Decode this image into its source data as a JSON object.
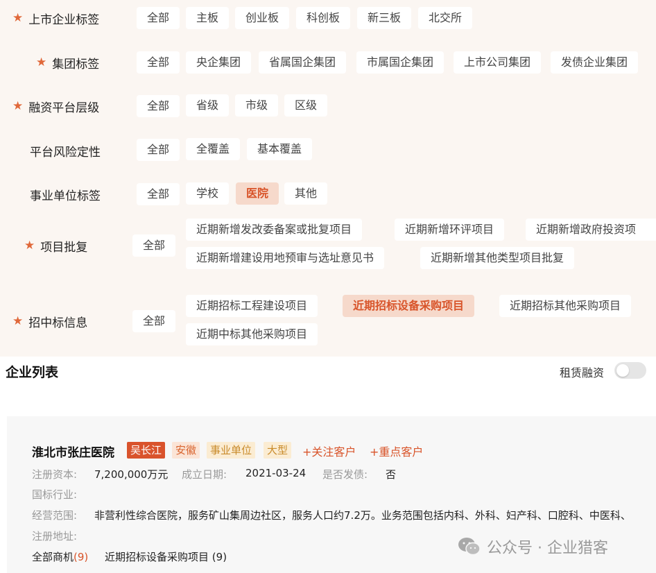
{
  "filters": {
    "listing": {
      "label": "上市企业标签",
      "tags": [
        "全部",
        "主板",
        "创业板",
        "科创板",
        "新三板",
        "北交所"
      ]
    },
    "group": {
      "label": "集团标签",
      "tags": [
        "全部",
        "央企集团",
        "省属国企集团",
        "市属国企集团",
        "上市公司集团",
        "发债企业集团"
      ]
    },
    "platform_level": {
      "label": "融资平台层级",
      "tags": [
        "全部",
        "省级",
        "市级",
        "区级"
      ]
    },
    "platform_risk": {
      "label": "平台风险定性",
      "tags": [
        "全部",
        "全覆盖",
        "基本覆盖"
      ]
    },
    "institution": {
      "label": "事业单位标签",
      "tags": [
        "全部",
        "学校",
        "医院",
        "其他"
      ]
    },
    "project_approval": {
      "label": "项目批复",
      "all": "全部",
      "tags": [
        "近期新增发改委备案或批复项目",
        "近期新增环评项目",
        "近期新增政府投资项",
        "近期新增建设用地预审与选址意见书",
        "近期新增其他类型项目批复"
      ]
    },
    "bidding": {
      "label": "招中标信息",
      "all": "全部",
      "tags": [
        "近期招标工程建设项目",
        "近期招标设备采购项目",
        "近期招标其他采购项目",
        "近期中标其他采购项目"
      ]
    }
  },
  "list": {
    "title": "企业列表",
    "lease_label": "租赁融资"
  },
  "company": {
    "name": "淮北市张庄医院",
    "badges": [
      "吴长江",
      "安徽",
      "事业单位",
      "大型"
    ],
    "follow": "+关注客户",
    "key_client": "+重点客户",
    "capital_key": "注册资本:",
    "capital_val": "7,200,000万元",
    "founded_key": "成立日期:",
    "founded_val": "2021-03-24",
    "bond_key": "是否发债:",
    "bond_val": "否",
    "industry_key": "国标行业:",
    "scope_key": "经营范围:",
    "scope_val": "非营利性综合医院，服务矿山集周边社区，服务人口约7.2万。业务范围包括内科、外科、妇产科、口腔科、中医科、",
    "address_key": "注册地址:",
    "opps_all_label": "全部商机",
    "opps_all_count": "(9)",
    "opps_bid_label": "近期招标设备采购项目",
    "opps_bid_count": "(9)"
  },
  "watermark": {
    "text": "公众号 · 企业猎客"
  },
  "colors": {
    "accent": "#d8542a",
    "panel_bg": "#fbf6f2",
    "active_tag_bg": "#f6d9cb"
  }
}
